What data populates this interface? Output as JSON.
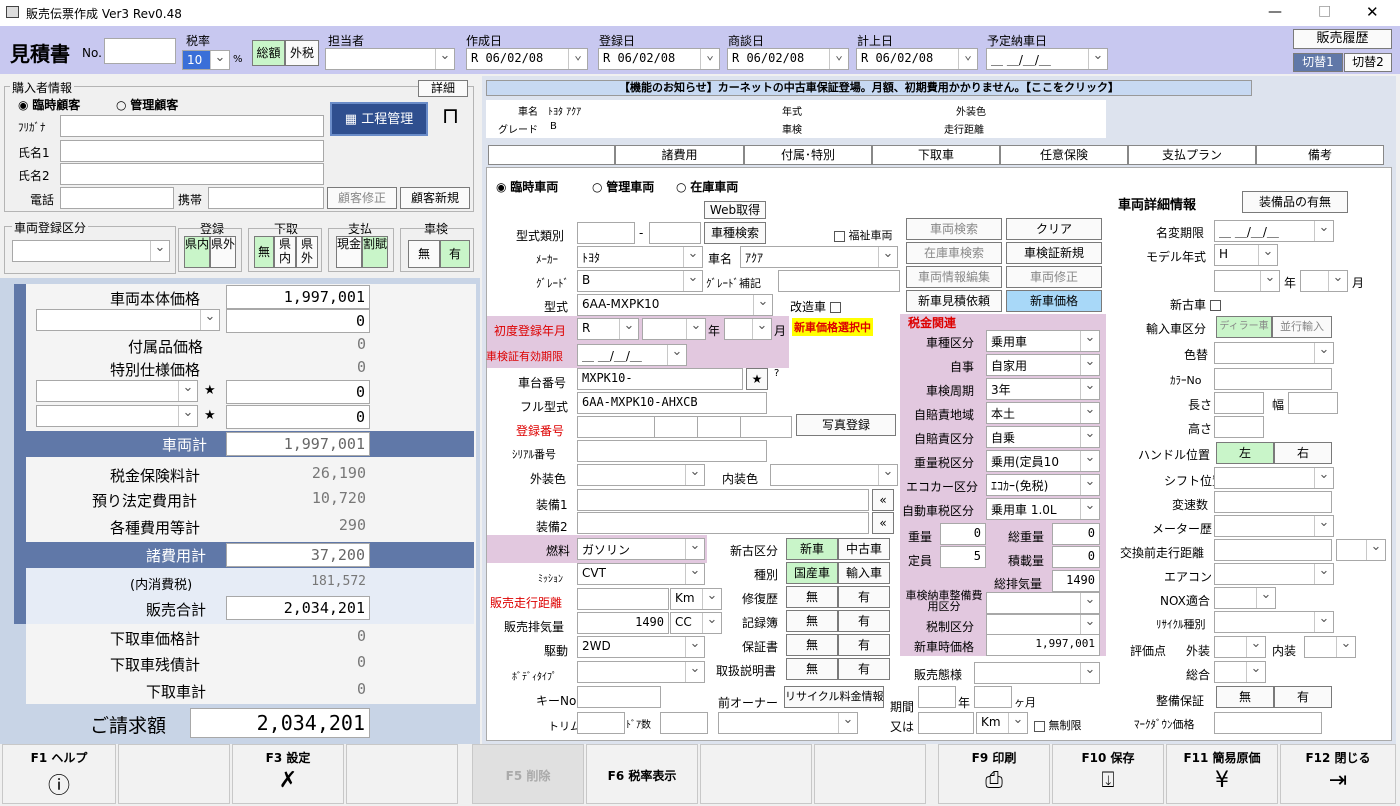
{
  "window": {
    "title": "販売伝票作成 Ver3 Rev0.48",
    "min": "—",
    "max": "□",
    "close": "✕"
  },
  "header": {
    "doc_type": "見積書",
    "no_label": "No.",
    "no_value": "",
    "tax_rate_label": "税率",
    "tax_rate": "10",
    "pct": "%",
    "tax_sum": "総額",
    "tax_ex": "外税",
    "staff_label": "担当者",
    "staff": "",
    "created_label": "作成日",
    "created": "R 06/02/08",
    "registered_label": "登録日",
    "registered": "R 06/02/08",
    "negotiated_label": "商談日",
    "negotiated": "R 06/02/08",
    "booked_label": "計上日",
    "booked": "R 06/02/08",
    "delivery_label": "予定納車日",
    "delivery": "＿ ＿/＿/＿",
    "history_btn": "販売履歴",
    "switch1": "切替1",
    "switch2": "切替2"
  },
  "buyer": {
    "section": "購入者情報",
    "detail_btn": "詳細",
    "temp": "臨時顧客",
    "managed": "管理顧客",
    "furigana": "ﾌﾘｶﾞﾅ",
    "name1": "氏名1",
    "name2": "氏名2",
    "phone": "電話",
    "mobile": "携帯",
    "edit_btn": "顧客修正",
    "new_btn": "顧客新規",
    "process_btn": "工程管理"
  },
  "reg": {
    "section": "車両登録区分",
    "reg_label": "登録",
    "reg_in": "県内",
    "reg_out": "県外",
    "trade_label": "下取",
    "trade_none": "無",
    "trade_in": "県内",
    "trade_out": "県外",
    "pay_label": "支払",
    "pay_cash": "現金",
    "pay_loan": "割賦",
    "inspect_label": "車検",
    "inspect_none": "無",
    "inspect_yes": "有"
  },
  "summary": {
    "body_label": "車両本体価格",
    "body": "1,997,001",
    "blank1": "0",
    "acc_label": "付属品価格",
    "acc": "0",
    "spec_label": "特別仕様価格",
    "spec": "0",
    "star1": "0",
    "star2": "0",
    "vehicle_total_label": "車両計",
    "vehicle_total": "1,997,001",
    "tax_ins_label": "税金保険料計",
    "tax_ins": "26,190",
    "deposit_label": "預り法定費用計",
    "deposit": "10,720",
    "misc_label": "各種費用等計",
    "misc": "290",
    "fees_total_label": "諸費用計",
    "fees_total": "37,200",
    "incl_tax_label": "(内消費税)",
    "incl_tax": "181,572",
    "sale_total_label": "販売合計",
    "sale_total": "2,034,201",
    "trade_price_label": "下取車価格計",
    "trade_price": "0",
    "trade_debt_label": "下取車残債計",
    "trade_debt": "0",
    "trade_total_label": "下取車計",
    "trade_total": "0",
    "invoice_label": "ご請求額",
    "invoice": "2,034,201"
  },
  "notice": "【機能のお知らせ】カーネットの中古車保証登場。月額、初期費用かかりません。【ここをクリック】",
  "info": {
    "car_name_label": "車名",
    "car_name": "ﾄﾖﾀ ｱｸｱ",
    "grade_label": "グレード",
    "grade": "B",
    "year_label": "年式",
    "inspect_label": "車検",
    "color_label": "外装色",
    "mileage_label": "走行距離"
  },
  "tabs": [
    "車両",
    "諸費用",
    "付属･特別",
    "下取車",
    "任意保険",
    "支払プラン",
    "備考"
  ],
  "vehicle": {
    "temp": "臨時車両",
    "managed": "管理車両",
    "stock": "在庫車両",
    "web_btn": "Web取得",
    "type_class": "型式類別",
    "search_btn": "車種検索",
    "welfare": "福祉車両",
    "maker_label": "ﾒｰｶｰ",
    "maker": "ﾄﾖﾀ",
    "carname_label": "車名",
    "carname": "ｱｸｱ",
    "grade_label": "ｸﾞﾚｰﾄﾞ",
    "grade": "B",
    "grade_sup": "ｸﾞﾚｰﾄﾞ補記",
    "model_label": "型式",
    "model": "6AA-MXPK10",
    "modified": "改造車",
    "first_reg": "初度登録年月",
    "first_reg_val": "R",
    "year": "年",
    "month": "月",
    "new_price_sel": "新車価格選択中",
    "inspect_exp": "車検証有効期限",
    "inspect_exp_val": "＿ ＿/＿/＿",
    "chassis_label": "車台番号",
    "chassis": "MXPK10-",
    "full_model_label": "フル型式",
    "full_model": "6AA-MXPK10-AHXCB",
    "reg_no": "登録番号",
    "photo_btn": "写真登録",
    "serial": "ｼﾘｱﾙ番号",
    "ext_color": "外装色",
    "int_color": "内装色",
    "equip1": "装備1",
    "equip2": "装備2",
    "fuel_label": "燃料",
    "fuel": "ガソリン",
    "trans_label": "ﾐｯｼｮﾝ",
    "trans": "CVT",
    "run_label": "販売走行距離",
    "km": "Km",
    "disp_label": "販売排気量",
    "disp": "1490",
    "cc": "CC",
    "drive_label": "駆動",
    "drive": "2WD",
    "body_label": "ﾎﾞﾃﾞｨﾀｲﾌﾟ",
    "key_label": "キーNo",
    "trim_label": "トリム",
    "doors_label": "ﾄﾞｱ数",
    "newused_label": "新古区分",
    "new": "新車",
    "used": "中古車",
    "kind_label": "種別",
    "domestic": "国産車",
    "import": "輸入車",
    "repair_label": "修復歴",
    "record_label": "記録簿",
    "warranty_label": "保証書",
    "manual_label": "取扱説明書",
    "none": "無",
    "yes": "有",
    "prev_owner": "前オーナー",
    "recycle_btn": "リサイクル料金情報"
  },
  "mid_btns": {
    "car_search": "車両検索",
    "clear": "クリア",
    "stock_search": "在庫車検索",
    "inspect_new": "車検証新規",
    "info_edit": "車両情報編集",
    "car_fix": "車両修正",
    "new_quote": "新車見積依頼",
    "new_price": "新車価格"
  },
  "tax": {
    "title": "税金関連",
    "class_label": "車種区分",
    "class": "乗用車",
    "own_label": "自事",
    "own": "自家用",
    "period_label": "車検周期",
    "period": "3年",
    "area_label": "自賠責地域",
    "area": "本土",
    "liab_label": "自賠責区分",
    "liab": "自乗",
    "weight_tax_label": "重量税区分",
    "weight_tax": "乗用(定員10",
    "eco_label": "エコカー区分",
    "eco": "ｴｺｶｰ(免税)",
    "auto_tax_label": "自動車税区分",
    "auto_tax": "乗用車 1.0L",
    "weight_label": "重量",
    "weight": "0",
    "gross_label": "総重量",
    "gross": "0",
    "cap_label": "定員",
    "cap": "5",
    "load_label": "積載量",
    "load": "0",
    "total_disp_label": "総排気量",
    "total_disp": "1490",
    "maint_label": "車検納車整備費用区分",
    "ins_label": "税制区分",
    "newprice_label": "新車時価格",
    "newprice": "1,997,001",
    "sale_form": "販売態様",
    "period2": "期間",
    "yr": "年",
    "ym": "ヶ月",
    "or": "又は",
    "km": "Km",
    "unlimited": "無制限"
  },
  "detail": {
    "title": "車両詳細情報",
    "equip_btn": "装備品の有無",
    "name_change": "名変期限",
    "name_change_val": "＿ ＿/＿/＿",
    "model_year": "モデル年式",
    "model_year_val": "H",
    "yr": "年",
    "mo": "月",
    "new_used": "新古車",
    "import_class": "輸入車区分",
    "dealer": "ディラー車",
    "parallel": "並行輸入",
    "color_change": "色替",
    "color_no": "ｶﾗｰNo",
    "length": "長さ",
    "width": "幅",
    "height": "高さ",
    "handle": "ハンドル位置",
    "left": "左",
    "right": "右",
    "shift": "シフト位置",
    "gears": "変速数",
    "meter": "メーター歴",
    "prev_mileage": "交換前走行距離",
    "aircon": "エアコン",
    "nox": "NOX適合",
    "recycle": "ﾘｻｲｸﾙ種別",
    "eval": "評価点",
    "exterior": "外装",
    "interior": "内装",
    "overall": "総合",
    "maint_warranty": "整備保証",
    "none": "無",
    "yes": "有",
    "markdown": "ﾏｰｸﾀﾞｳﾝ価格"
  },
  "fkeys": {
    "f1": "F1 ヘルプ",
    "f3": "F3 設定",
    "f5": "F5 削除",
    "f6": "F6 税率表示",
    "f9": "F9 印刷",
    "f10": "F10 保存",
    "f11": "F11 簡易原価",
    "f12": "F12 閉じる"
  }
}
